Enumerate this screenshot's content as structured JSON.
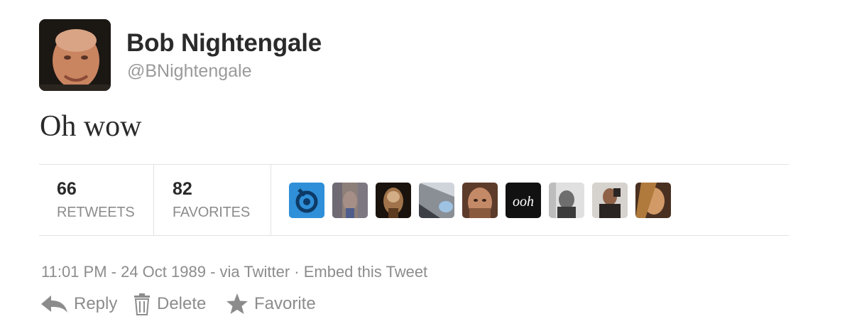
{
  "profile": {
    "name": "Bob Nightengale",
    "handle": "@BNightengale"
  },
  "tweet": {
    "text": "Oh wow"
  },
  "stats": {
    "retweets": {
      "count": "66",
      "label": "RETWEETS"
    },
    "favorites": {
      "count": "82",
      "label": "FAVORITES"
    }
  },
  "favoriters": [
    {
      "name": "favoriter-avatar-1",
      "text": ""
    },
    {
      "name": "favoriter-avatar-2",
      "text": ""
    },
    {
      "name": "favoriter-avatar-3",
      "text": ""
    },
    {
      "name": "favoriter-avatar-4",
      "text": ""
    },
    {
      "name": "favoriter-avatar-5",
      "text": ""
    },
    {
      "name": "favoriter-avatar-6",
      "text": "ooh"
    },
    {
      "name": "favoriter-avatar-7",
      "text": ""
    },
    {
      "name": "favoriter-avatar-8",
      "text": ""
    },
    {
      "name": "favoriter-avatar-9",
      "text": ""
    }
  ],
  "meta": {
    "timestamp": "11:01 PM - 24 Oct 1989",
    "sep1": " - ",
    "via": "via Twitter",
    "sep2": " · ",
    "embed": "Embed this Tweet"
  },
  "actions": {
    "reply": "Reply",
    "delete": "Delete",
    "favorite": "Favorite"
  },
  "icons": {
    "reply": "reply-arrow-icon",
    "delete": "trash-icon",
    "favorite": "star-icon"
  },
  "colors": {
    "text": "#2a2a2a",
    "muted": "#8c8c8c",
    "divider": "#e2e2e2"
  }
}
